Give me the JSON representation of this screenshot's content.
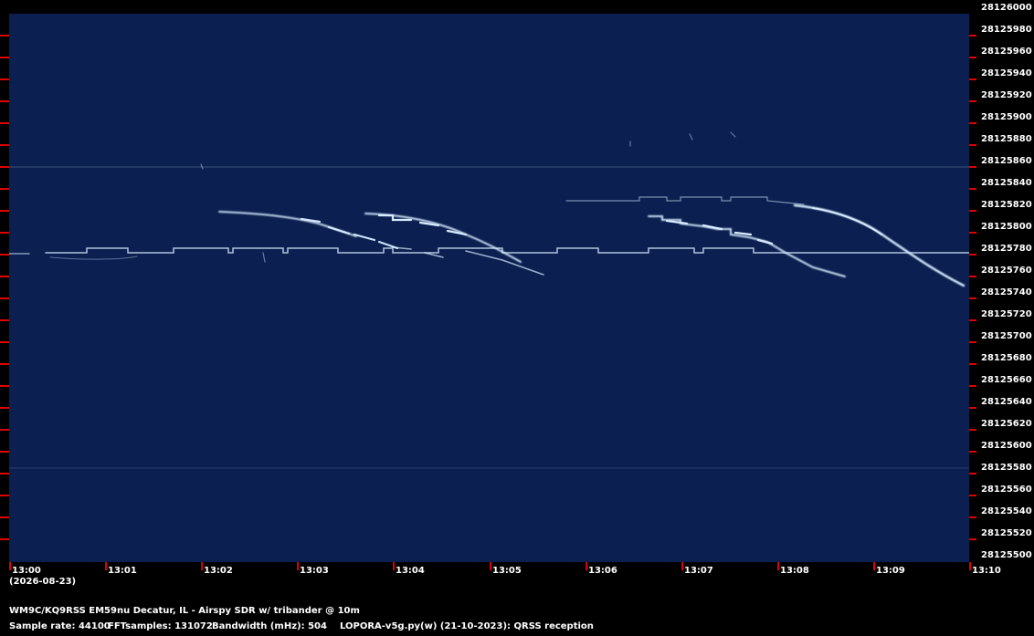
{
  "spectrogram": {
    "background_color": "#0b2050",
    "trace_color": "#d8ecff",
    "frequency_labels": [
      "28126000",
      "28125980",
      "28125960",
      "28125940",
      "28125920",
      "28125900",
      "28125880",
      "28125860",
      "28125840",
      "28125820",
      "28125800",
      "28125780",
      "28125760",
      "28125740",
      "28125720",
      "28125700",
      "28125680",
      "28125660",
      "28125640",
      "28125620",
      "28125600",
      "28125580",
      "28125560",
      "28125540",
      "28125520",
      "28125500"
    ],
    "time_labels": [
      "13:00",
      "13:01",
      "13:02",
      "13:03",
      "13:04",
      "13:05",
      "13:06",
      "13:07",
      "13:08",
      "13:09",
      "13:10"
    ],
    "date_label": "(2026-08-23)"
  },
  "footer": {
    "station": "WM9C/KQ9RSS EM59nu Decatur, IL - Airspy SDR w/ tribander @ 10m",
    "sample_rate": "Sample rate: 44100",
    "fft_samples": "FFTsamples: 131072",
    "bandwidth": "Bandwidth (mHz): 504",
    "software": "LOPORA-v5g.py(w) (21-10-2023): QRSS reception"
  },
  "colors": {
    "tick": "#e00000",
    "text": "#ffffff"
  }
}
